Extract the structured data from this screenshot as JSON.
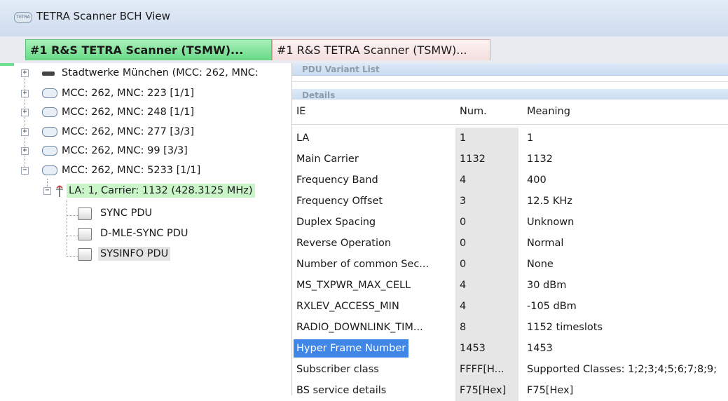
{
  "window": {
    "title": "TETRA Scanner BCH View",
    "icon": "tetra-app-icon"
  },
  "tabs": [
    {
      "label": "#1 R&S TETRA Scanner (TSMW)...",
      "active": true
    },
    {
      "label": "#1 R&S TETRA Scanner (TSMW)...",
      "active": false
    }
  ],
  "tree": {
    "nodes": [
      {
        "label": "Stadtwerke München (MCC: 262, MNC:",
        "expander": "+"
      },
      {
        "label": "MCC: 262, MNC: 223 [1/1]",
        "expander": "+"
      },
      {
        "label": "MCC: 262, MNC: 248 [1/1]",
        "expander": "+"
      },
      {
        "label": "MCC: 262, MNC: 277 [3/3]",
        "expander": "+"
      },
      {
        "label": "MCC: 262, MNC: 99 [3/3]",
        "expander": "+"
      },
      {
        "label": "MCC: 262, MNC: 5233 [1/1]",
        "expander": "−"
      },
      {
        "label": "LA: 1, Carrier: 1132 (428.3125 MHz)",
        "expander": "−"
      },
      {
        "label": "SYNC PDU"
      },
      {
        "label": "D-MLE-SYNC PDU"
      },
      {
        "label": "SYSINFO PDU"
      }
    ]
  },
  "sections": {
    "variant_list": "PDU Variant List",
    "details": "Details"
  },
  "details": {
    "columns": [
      "IE",
      "Num.",
      "Meaning"
    ],
    "rows": [
      {
        "ie": "LA",
        "num": "1",
        "meaning": "1"
      },
      {
        "ie": "Main Carrier",
        "num": "1132",
        "meaning": "1132"
      },
      {
        "ie": "Frequency Band",
        "num": "4",
        "meaning": "400"
      },
      {
        "ie": "Frequency Offset",
        "num": "3",
        "meaning": "12.5 KHz"
      },
      {
        "ie": "Duplex Spacing",
        "num": "0",
        "meaning": "Unknown"
      },
      {
        "ie": "Reverse Operation",
        "num": "0",
        "meaning": "Normal"
      },
      {
        "ie": "Number of common Sec...",
        "num": "0",
        "meaning": "None"
      },
      {
        "ie": "MS_TXPWR_MAX_CELL",
        "num": "4",
        "meaning": "30 dBm"
      },
      {
        "ie": "RXLEV_ACCESS_MIN",
        "num": "4",
        "meaning": "-105 dBm"
      },
      {
        "ie": "RADIO_DOWNLINK_TIM...",
        "num": "8",
        "meaning": "1152 timeslots"
      },
      {
        "ie": "Hyper Frame Number",
        "num": "1453",
        "meaning": "1453"
      },
      {
        "ie": "Subscriber class",
        "num": "FFFF[H...",
        "meaning": "Supported Classes: 1;2;3;4;5;6;7;8;9;"
      },
      {
        "ie": "BS service details",
        "num": "F75[Hex]",
        "meaning": "F75[Hex]"
      }
    ]
  },
  "colors": {
    "active_tab": "#67d987",
    "inactive_tab": "#f4dede",
    "selection": "#3f86e6",
    "section_header": "#c9dcf1"
  }
}
